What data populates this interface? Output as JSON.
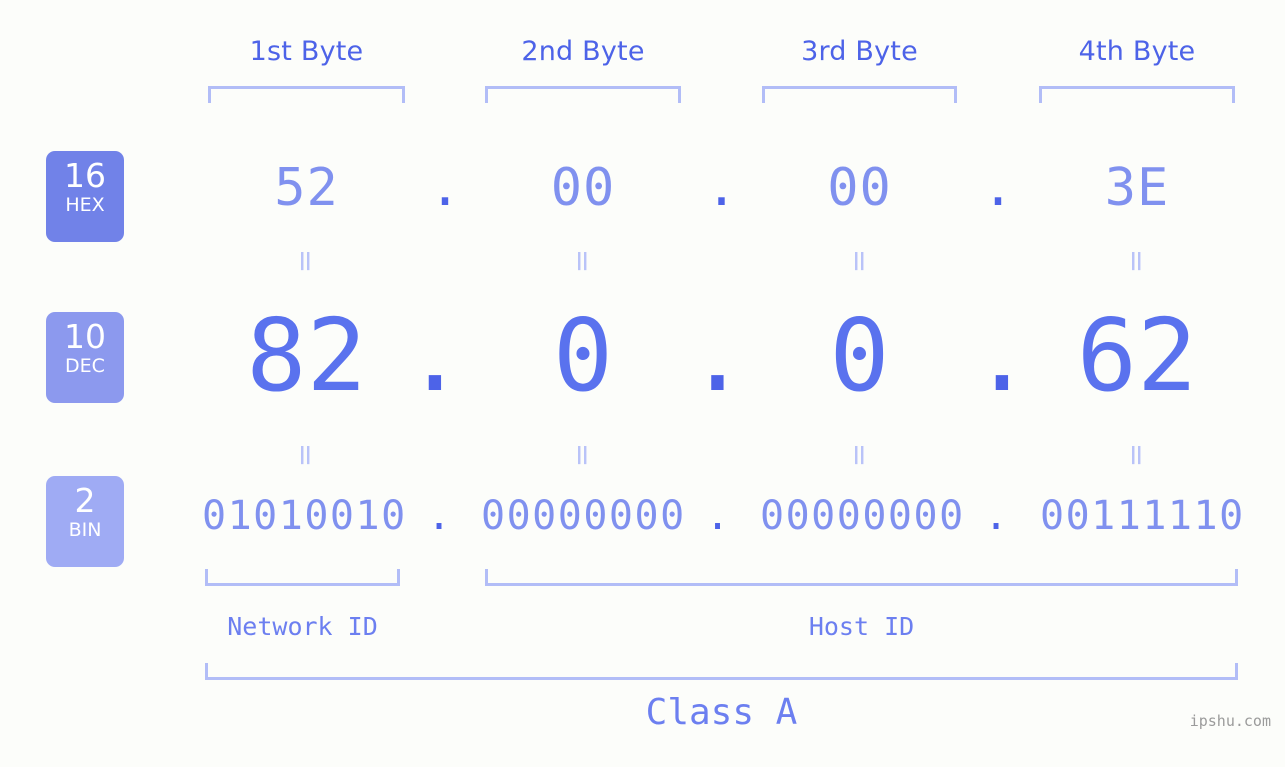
{
  "colors": {
    "background": "#fcfdfa",
    "accent_strong": "#4d63e8",
    "accent_mid": "#5a72ee",
    "accent_light": "#8091ef",
    "bracket": "#b2bdf7",
    "badge_hex": "#7182e8",
    "badge_dec": "#8c99ee",
    "badge_bin": "#9fabf4",
    "watermark": "#9b9b9b"
  },
  "byte_headers": [
    {
      "label": "1st Byte"
    },
    {
      "label": "2nd Byte"
    },
    {
      "label": "3rd Byte"
    },
    {
      "label": "4th Byte"
    }
  ],
  "bases": [
    {
      "number": "16",
      "name": "HEX"
    },
    {
      "number": "10",
      "name": "DEC"
    },
    {
      "number": "2",
      "name": "BIN"
    }
  ],
  "rows": {
    "hex": {
      "base_number": "16",
      "base_name": "HEX",
      "values": [
        "52",
        "00",
        "00",
        "3E"
      ],
      "separator": "."
    },
    "dec": {
      "base_number": "10",
      "base_name": "DEC",
      "values": [
        "82",
        "0",
        "0",
        "62"
      ],
      "separator": "."
    },
    "bin": {
      "base_number": "2",
      "base_name": "BIN",
      "values": [
        "01010010",
        "00000000",
        "00000000",
        "00111110"
      ],
      "separator": "."
    }
  },
  "equals_symbol": "=",
  "sections": [
    {
      "label": "Network ID"
    },
    {
      "label": "Host ID"
    }
  ],
  "class_label": "Class A",
  "watermark": "ipshu.com",
  "address": {
    "hex": "52.00.00.3E",
    "dec": "82.0.0.62",
    "bin": "01010010.00000000.00000000.00111110"
  }
}
